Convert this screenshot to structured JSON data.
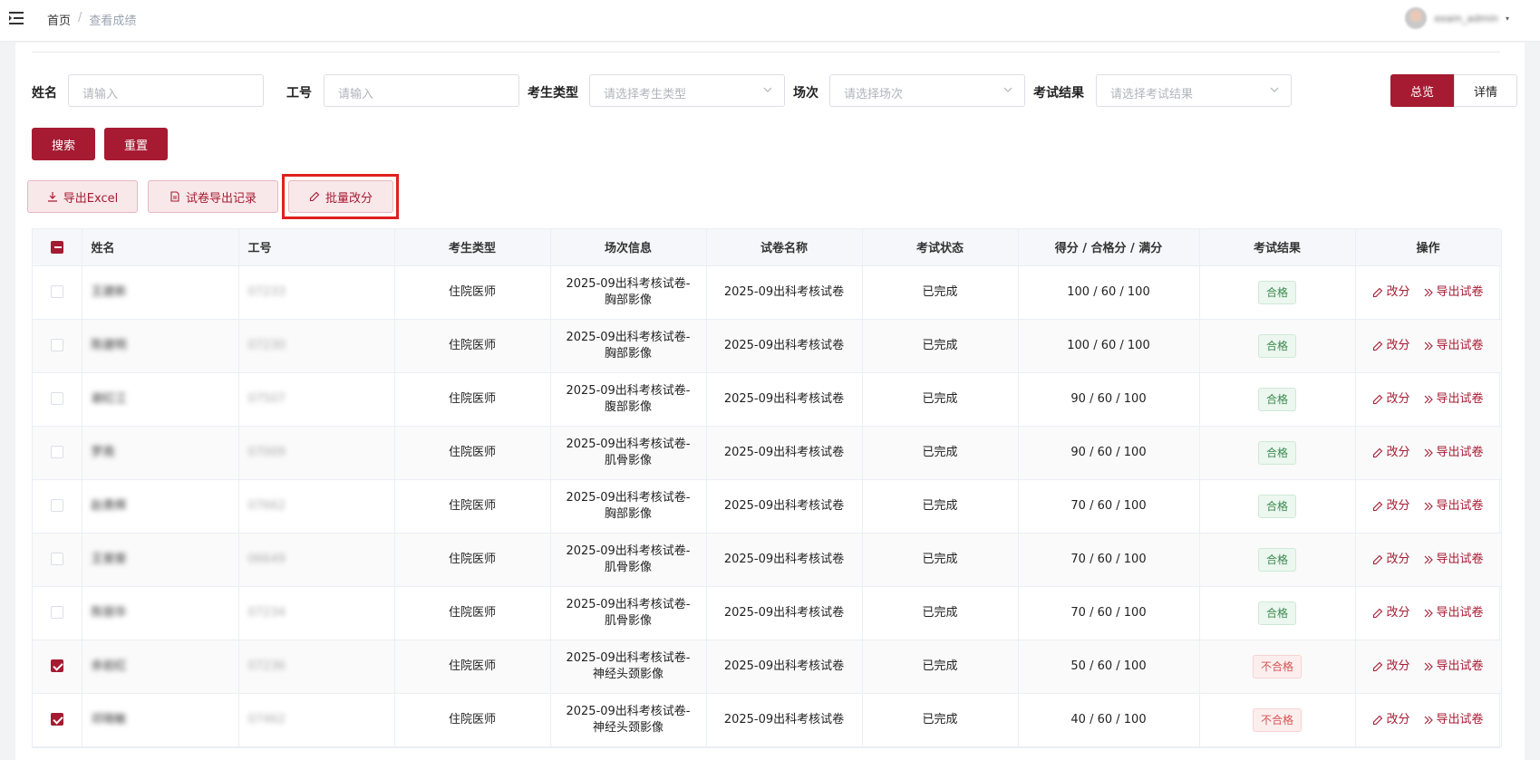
{
  "header": {
    "breadcrumb_home": "首页",
    "breadcrumb_sep": "/",
    "breadcrumb_current": "查看成绩",
    "username": "exam_admin",
    "caret": "▾"
  },
  "filters": {
    "name_label": "姓名",
    "name_placeholder": "请输入",
    "id_label": "工号",
    "id_placeholder": "请输入",
    "type_label": "考生类型",
    "type_placeholder": "请选择考生类型",
    "session_label": "场次",
    "session_placeholder": "请选择场次",
    "result_label": "考试结果",
    "result_placeholder": "请选择考试结果",
    "view_overview": "总览",
    "view_detail": "详情"
  },
  "actions": {
    "search": "搜索",
    "reset": "重置",
    "export_excel": "导出Excel",
    "paper_export_log": "试卷导出记录",
    "batch_regrade": "批量改分"
  },
  "table": {
    "headers": {
      "name": "姓名",
      "id": "工号",
      "type": "考生类型",
      "session": "场次信息",
      "paper": "试卷名称",
      "status": "考试状态",
      "score": "得分 / 合格分 / 满分",
      "result": "考试结果",
      "ops": "操作"
    },
    "op_regrade": "改分",
    "op_export": "导出试卷",
    "rows": [
      {
        "name": "王建新",
        "id": "07233",
        "type": "住院医师",
        "session_1": "2025-09出科考核试卷-",
        "session_2": "胸部影像",
        "paper": "2025-09出科考核试卷",
        "status": "已完成",
        "score": "100 / 60 / 100",
        "result": "合格",
        "pass": true,
        "checked": false
      },
      {
        "name": "陈建明",
        "id": "07230",
        "type": "住院医师",
        "session_1": "2025-09出科考核试卷-",
        "session_2": "胸部影像",
        "paper": "2025-09出科考核试卷",
        "status": "已完成",
        "score": "100 / 60 / 100",
        "result": "合格",
        "pass": true,
        "checked": false
      },
      {
        "name": "谢红江",
        "id": "07507",
        "type": "住院医师",
        "session_1": "2025-09出科考核试卷-",
        "session_2": "腹部影像",
        "paper": "2025-09出科考核试卷",
        "status": "已完成",
        "score": "90 / 60 / 100",
        "result": "合格",
        "pass": true,
        "checked": false
      },
      {
        "name": "罗南",
        "id": "07009",
        "type": "住院医师",
        "session_1": "2025-09出科考核试卷-",
        "session_2": "肌骨影像",
        "paper": "2025-09出科考核试卷",
        "status": "已完成",
        "score": "90 / 60 / 100",
        "result": "合格",
        "pass": true,
        "checked": false
      },
      {
        "name": "赵勇辉",
        "id": "07662",
        "type": "住院医师",
        "session_1": "2025-09出科考核试卷-",
        "session_2": "胸部影像",
        "paper": "2025-09出科考核试卷",
        "status": "已完成",
        "score": "70 / 60 / 100",
        "result": "合格",
        "pass": true,
        "checked": false
      },
      {
        "name": "王斐斐",
        "id": "06649",
        "type": "住院医师",
        "session_1": "2025-09出科考核试卷-",
        "session_2": "肌骨影像",
        "paper": "2025-09出科考核试卷",
        "status": "已完成",
        "score": "70 / 60 / 100",
        "result": "合格",
        "pass": true,
        "checked": false
      },
      {
        "name": "陈丽华",
        "id": "07234",
        "type": "住院医师",
        "session_1": "2025-09出科考核试卷-",
        "session_2": "肌骨影像",
        "paper": "2025-09出科考核试卷",
        "status": "已完成",
        "score": "70 / 60 / 100",
        "result": "合格",
        "pass": true,
        "checked": false
      },
      {
        "name": "余岩红",
        "id": "07236",
        "type": "住院医师",
        "session_1": "2025-09出科考核试卷-",
        "session_2": "神经头颈影像",
        "paper": "2025-09出科考核试卷",
        "status": "已完成",
        "score": "50 / 60 / 100",
        "result": "不合格",
        "pass": false,
        "checked": true
      },
      {
        "name": "邓晓敏",
        "id": "07462",
        "type": "住院医师",
        "session_1": "2025-09出科考核试卷-",
        "session_2": "神经头颈影像",
        "paper": "2025-09出科考核试卷",
        "status": "已完成",
        "score": "40 / 60 / 100",
        "result": "不合格",
        "pass": false,
        "checked": true
      }
    ]
  },
  "colors": {
    "primary": "#a61b32",
    "pass": "#3a8a4e",
    "fail": "#d45454",
    "highlight": "#e02020"
  }
}
